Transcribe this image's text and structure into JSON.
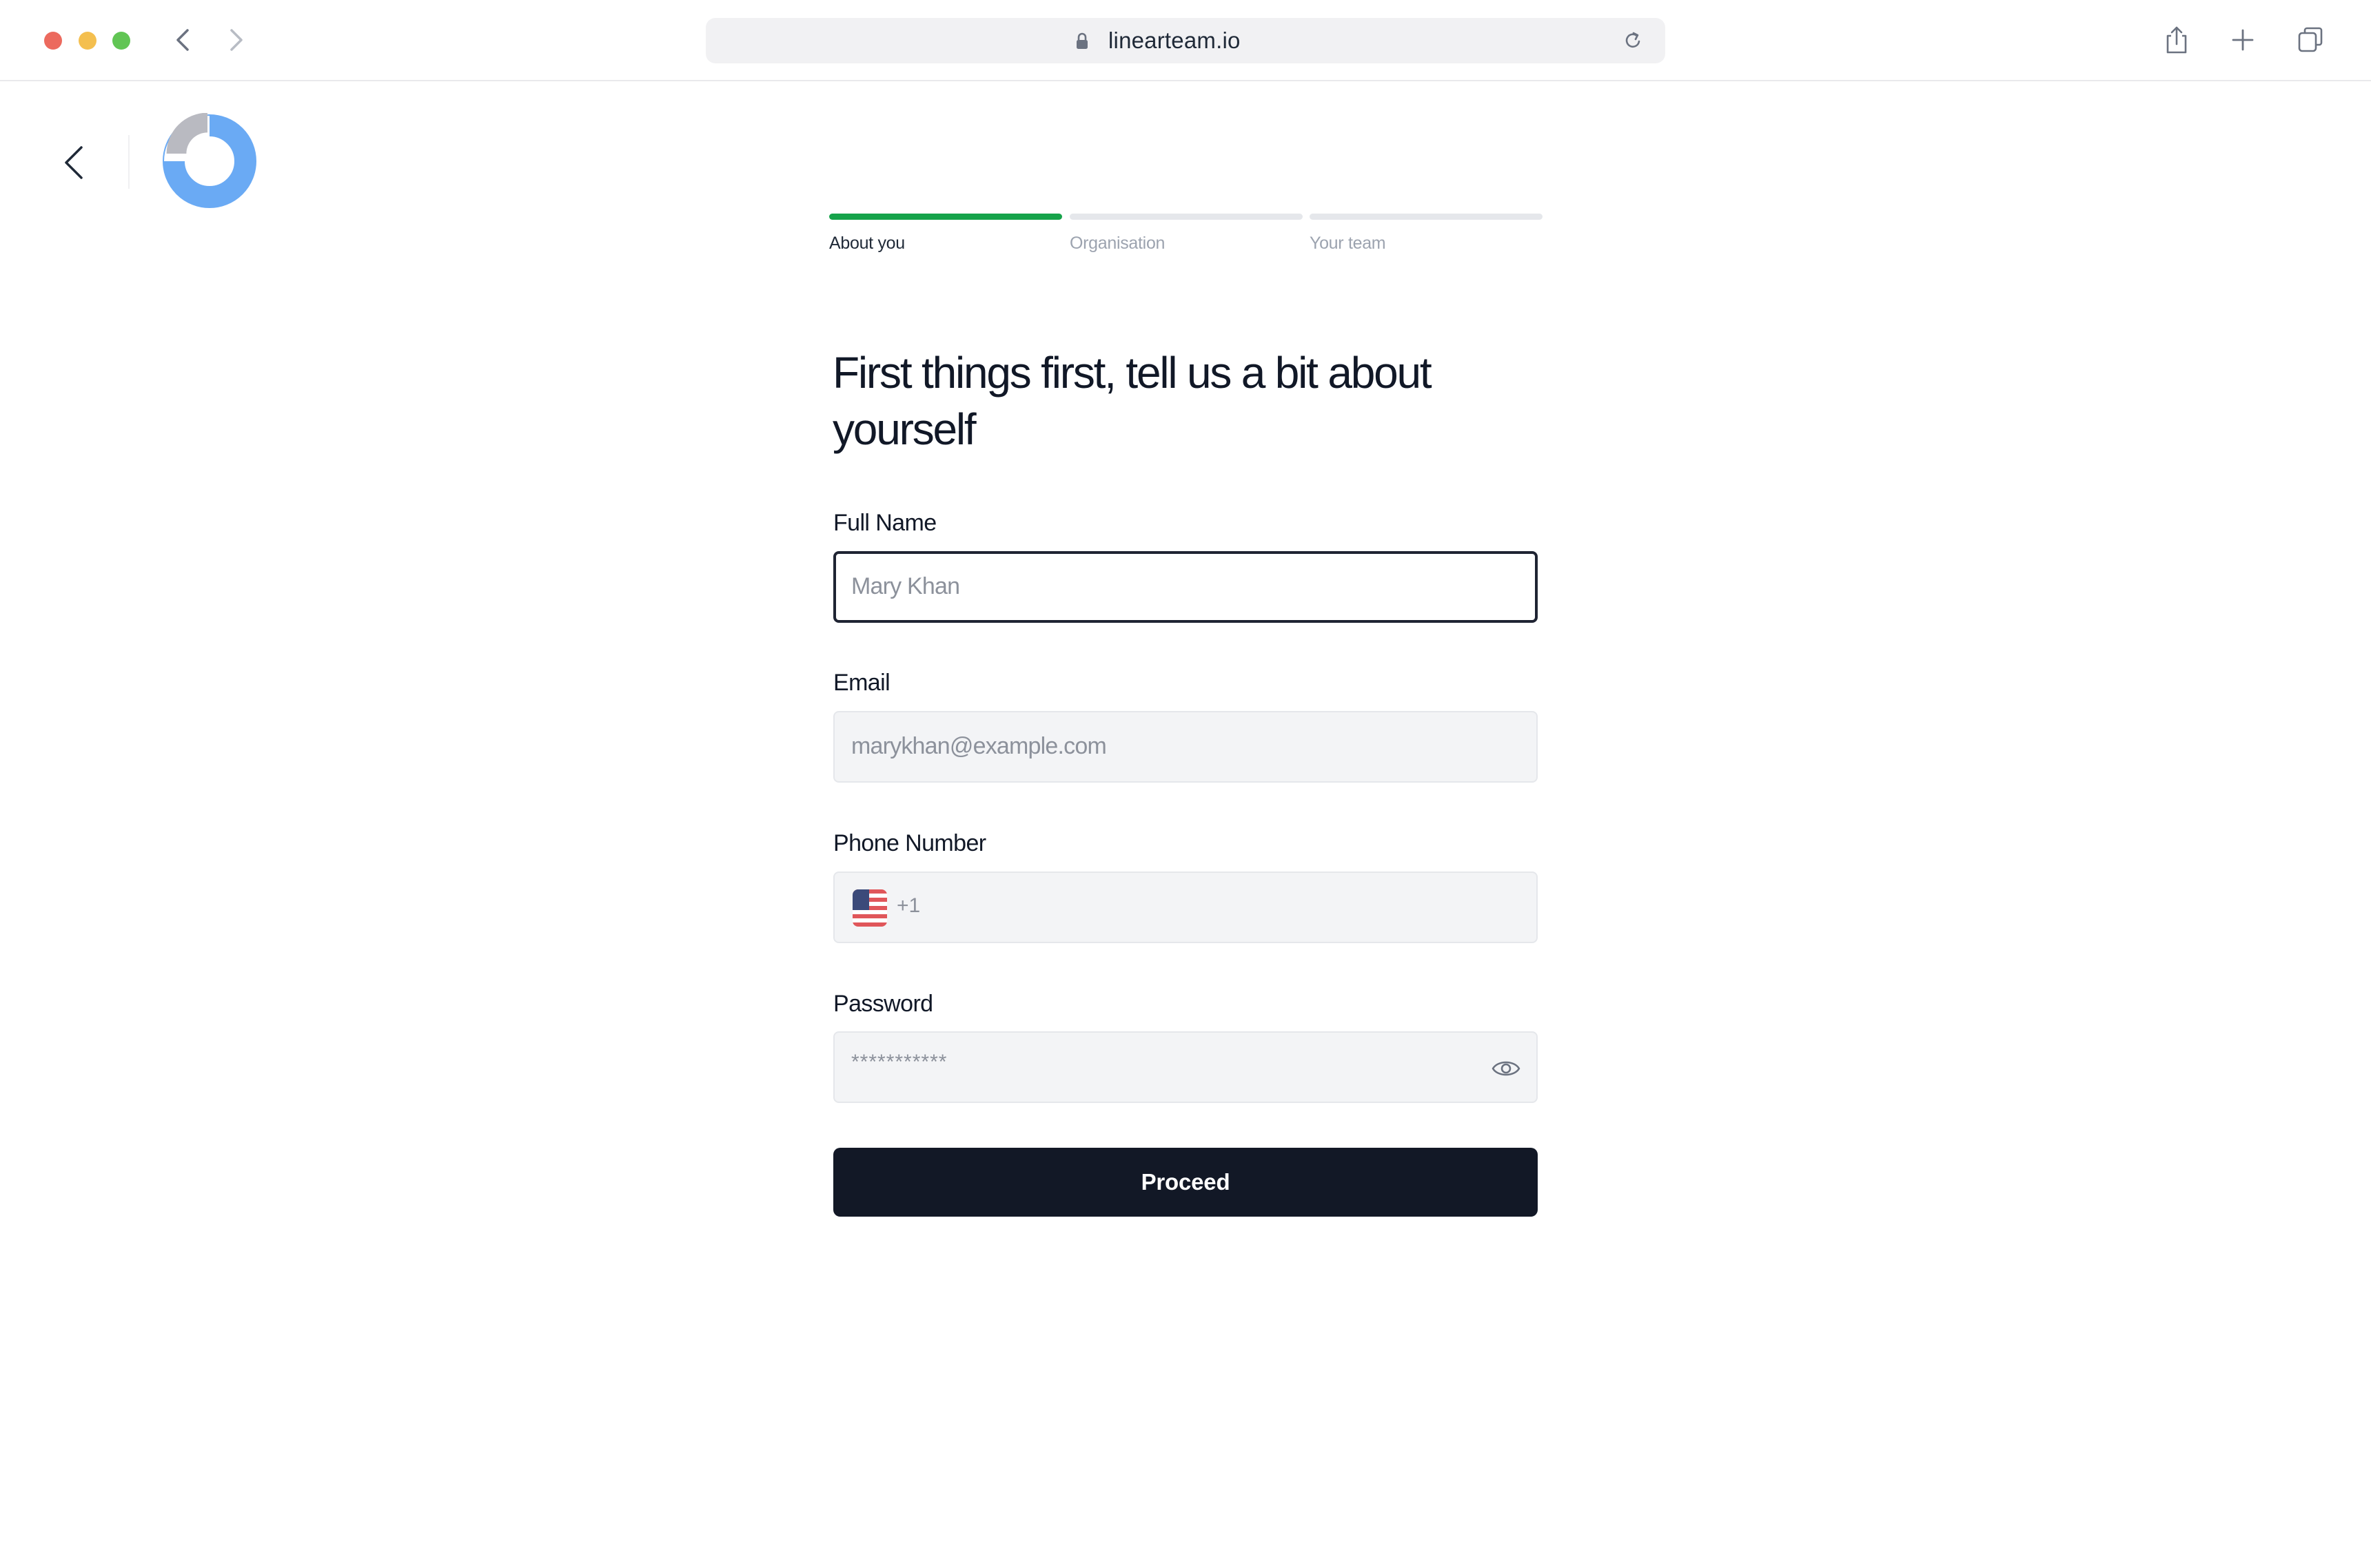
{
  "browser": {
    "url": "linearteam.io"
  },
  "stepper": {
    "steps": [
      {
        "label": "About you",
        "active": true
      },
      {
        "label": "Organisation",
        "active": false
      },
      {
        "label": "Your team",
        "active": false
      }
    ],
    "accent_color": "#16a34a"
  },
  "form": {
    "heading": "First things first, tell us a bit about yourself",
    "full_name": {
      "label": "Full Name",
      "placeholder": "Mary Khan"
    },
    "email": {
      "label": "Email",
      "placeholder": "marykhan@example.com"
    },
    "phone": {
      "label": "Phone Number",
      "country_code": "+1",
      "country_flag": "us-flag-icon"
    },
    "password": {
      "label": "Password",
      "masked_value": "***********"
    },
    "submit_label": "Proceed"
  },
  "colors": {
    "primary_button": "#121826",
    "logo_blue": "#6aaaf4",
    "logo_gray": "#b9bac1"
  }
}
